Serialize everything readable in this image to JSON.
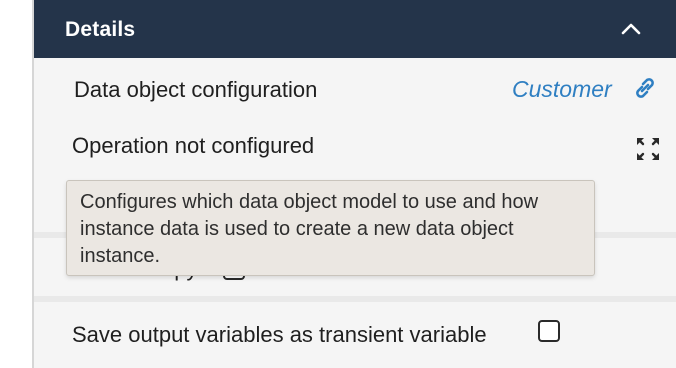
{
  "panel": {
    "title": "Details"
  },
  "rows": {
    "data_object_configuration": {
      "label": "Data object configuration",
      "link_value": "Customer"
    },
    "operation": {
      "label": "Operation not configured"
    },
    "store_copy": {
      "label": "Store a copy",
      "checked": false
    },
    "save_output": {
      "label": "Save output variables as transient variable",
      "checked": false
    }
  },
  "tooltip": {
    "text": "Configures which data object model to use and how instance data is used to create a new data object instance."
  },
  "icons": {
    "collapse": "chevron-up-icon",
    "link": "link-icon",
    "expand": "expand-icon"
  },
  "colors": {
    "header_bg": "#24344a",
    "link": "#2f7fc2",
    "tooltip_bg": "#ebe7e2"
  }
}
